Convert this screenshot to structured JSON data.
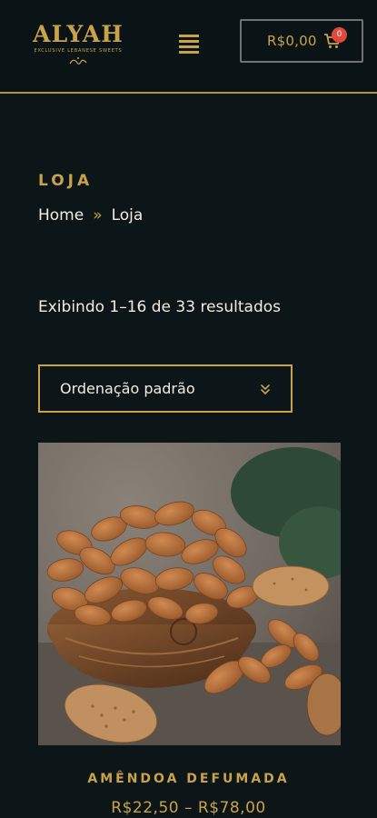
{
  "header": {
    "logo_word": "ALYAH",
    "logo_tagline": "EXCLUSIVE LEBANESE SWEETS",
    "cart_total": "R$0,00",
    "cart_count": "0"
  },
  "shop": {
    "page_title": "LOJA",
    "breadcrumb": {
      "home": "Home",
      "separator": "»",
      "current": "Loja"
    },
    "result_count": "Exibindo 1–16 de 33 resultados",
    "orderby_selected": "Ordenação padrão"
  },
  "products": [
    {
      "name": "AMÊNDOA DEFUMADA",
      "price": "R$22,50 – R$78,00"
    }
  ],
  "colors": {
    "background": "#0c1618",
    "accent_gold": "#c9a24a",
    "badge_red": "#e2483c"
  }
}
